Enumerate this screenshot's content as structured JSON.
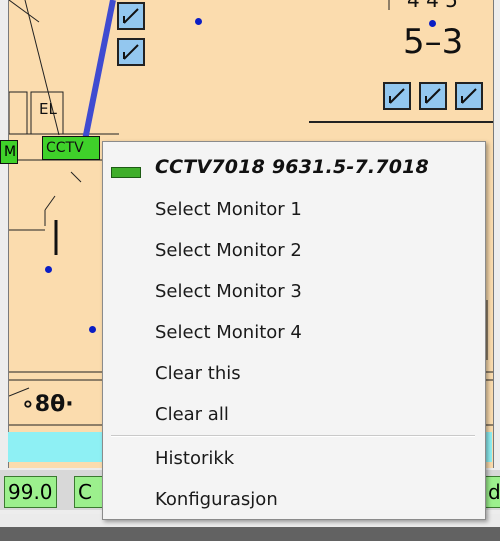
{
  "map": {
    "room_label_el": "EL",
    "room_number": "5–3",
    "room_number_top": "4 4 5",
    "cctv_tag": "CCTV",
    "left_edge_tag": "M",
    "right_edge_tag": "",
    "symbols_bottom": "∘8θ·"
  },
  "status": {
    "left_value": "99.0",
    "mid_value": "C",
    "right_value": "d"
  },
  "context_menu": {
    "header": "CCTV7018 9631.5-7.7018",
    "items": [
      "Select Monitor 1",
      "Select Monitor 2",
      "Select Monitor 3",
      "Select Monitor 4",
      "Clear this",
      "Clear all"
    ],
    "extra_items": [
      "Historikk",
      "Konfigurasjon"
    ]
  },
  "colors": {
    "floor": "#fbdcae",
    "camera": "#93c7ef",
    "status_chip": "#9cf08d",
    "accent_line": "#3f4bd1"
  }
}
